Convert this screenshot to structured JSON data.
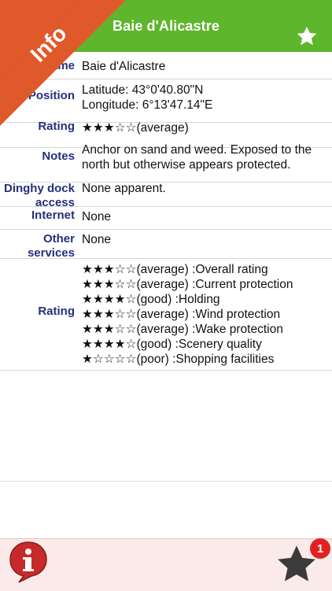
{
  "header": {
    "title": "Baie d'Alicastre",
    "ribbon_label": "Info"
  },
  "rows": {
    "name": {
      "label": "Name",
      "value": "Baie d'Alicastre"
    },
    "position": {
      "label": "Position",
      "latitude": "Latitude: 43°0'40.80\"N",
      "longitude": "Longitude: 6°13'47.14\"E"
    },
    "rating": {
      "label": "Rating",
      "value": "★★★☆☆(average)"
    },
    "notes": {
      "label": "Notes",
      "value": "Anchor on sand and weed.  Exposed to the north but otherwise appears protected."
    },
    "dinghy": {
      "label_line1": "Dinghy dock",
      "label_line2": "access",
      "value": "None apparent."
    },
    "internet": {
      "label": "Internet",
      "value": "None"
    },
    "other": {
      "label_line1": "Other",
      "label_line2": "services",
      "value": "None"
    },
    "ratings": {
      "label": "Rating",
      "items": [
        "★★★☆☆(average) :Overall rating",
        "★★★☆☆(average) :Current protection",
        "★★★★☆(good) :Holding",
        "★★★☆☆(average) :Wind protection",
        "★★★☆☆(average) :Wake protection",
        "★★★★☆(good) :Scenery quality",
        "★☆☆☆☆(poor) :Shopping facilities"
      ]
    }
  },
  "bottom": {
    "badge_count": "1"
  },
  "colors": {
    "header_green": "#5db62b",
    "ribbon_orange": "#e0592a",
    "label_navy": "#24307a",
    "info_red": "#c62a2a"
  }
}
